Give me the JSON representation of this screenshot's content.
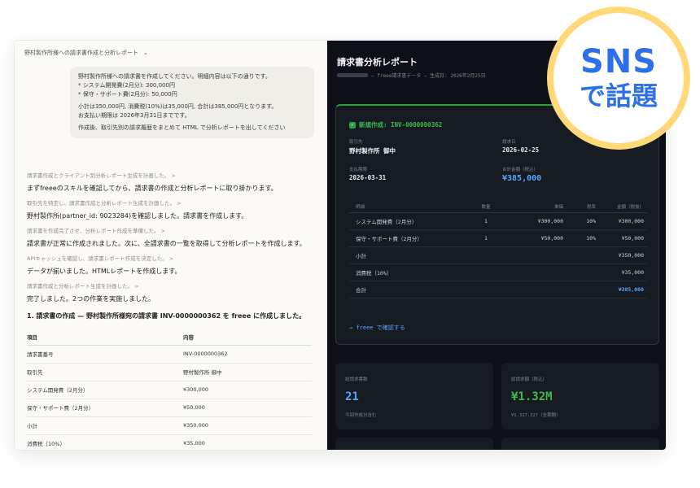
{
  "chat": {
    "title": "野村製作所様への請求書作成と分析レポート",
    "user_message": {
      "lines": [
        "野村製作所様への請求書を作成してください。明細内容は以下の通りです。",
        "* システム開発費(2月分): 300,000円",
        "* 保守・サポート費(2月分): 50,000円"
      ],
      "lines2": [
        "小計は350,000円, 消費税(10%)は35,000円, 合計は385,000円となります。",
        "お支払い期限は 2026年3月31日までです。"
      ],
      "lines3": [
        "作成後、取引先別の請求履歴をまとめて HTML で分析レポートを出してください"
      ]
    },
    "steps": [
      "請求書作成とクライアント別分析レポート生成を計画した。 >",
      "取引先を特定し、請求書作成と分析レポート生成を計画した。 >",
      "請求書を作成完了させ、分析レポート作成を準備した。 >",
      "APIキャッシュを確認し、請求書レポート作成を決定した。 >",
      "請求書作成と分析レポート生成を計画した。 >"
    ],
    "messages": [
      "まずfreeeのスキルを確認してから、請求書の作成と分析レポートに取り掛かります。",
      "野村製作所(partner_id: 9023284)を確認しました。請求書を作成します。",
      "請求書が正常に作成されました。次に、全請求書の一覧を取得して分析レポートを作成します。",
      "データが揃いました。HTMLレポートを作成します。",
      "完了しました。2つの作業を実施しました。"
    ],
    "summary_heading": "1. 請求書の作成 — 野村製作所様宛の請求書 INV-0000000362 を freee に作成しました。",
    "table": {
      "headers": [
        "項目",
        "内容"
      ],
      "rows": [
        [
          "請求書番号",
          "INV-0000000362"
        ],
        [
          "取引先",
          "野村製作所 御中"
        ],
        [
          "システム開発費（2月分）",
          "¥300,000"
        ],
        [
          "保守・サポート費（2月分）",
          "¥50,000"
        ],
        [
          "小計",
          "¥350,000"
        ],
        [
          "消費税（10%）",
          "¥35,000"
        ]
      ]
    }
  },
  "report": {
    "title": "請求書分析レポート",
    "subtitle": "— freee請求書データ — 生成日: 2026年2月25日",
    "card": {
      "badge": "新規作成: INV-0000000362",
      "partner_label": "取引先",
      "partner_value": "野村製作所 御中",
      "date_label": "請求日",
      "date_value": "2026-02-25",
      "due_label": "支払期限",
      "due_value": "2026-03-31",
      "total_label": "合計金額（税込）",
      "total_value": "¥385,000",
      "headers": [
        "明細",
        "数量",
        "単価",
        "税率",
        "金額（税抜）"
      ],
      "rows": [
        [
          "システム開発費（2月分）",
          "1",
          "¥300,000",
          "10%",
          "¥300,000"
        ],
        [
          "保守・サポート費（2月分）",
          "1",
          "¥50,000",
          "10%",
          "¥50,000"
        ]
      ],
      "subtotal_label": "小計",
      "subtotal_value": "¥350,000",
      "tax_label": "消費税（10%）",
      "tax_value": "¥35,000",
      "grand_label": "合計",
      "grand_value": "¥385,000",
      "link": "→ freee で確認する"
    },
    "stats": [
      {
        "label": "総請求書数",
        "value": "21",
        "note": "今回作成分含む",
        "color": "#58a6ff"
      },
      {
        "label": "総請求額（税込）",
        "value": "¥1.32M",
        "note": "¥1,317,327（全期間）",
        "color": "#3fb950"
      }
    ]
  },
  "sns_badge": {
    "line1": "SNS",
    "line2": "で話題"
  }
}
